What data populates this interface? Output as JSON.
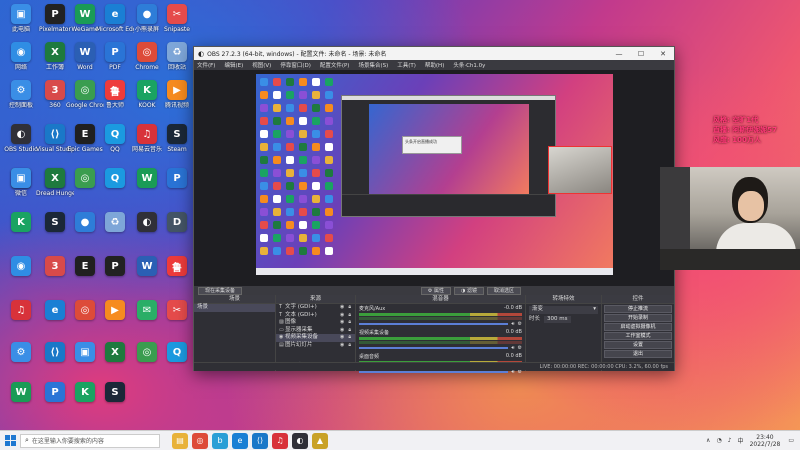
{
  "desktop": {
    "icons": [
      {
        "label": "此电脑",
        "icon": "computer-icon",
        "color": "#3a8ee6",
        "glyph": "▣"
      },
      {
        "label": "Pixelmator",
        "icon": "pixelmator-icon",
        "color": "#222222",
        "glyph": "P"
      },
      {
        "label": "WeGame",
        "icon": "wegame-icon",
        "color": "#1a9b56",
        "glyph": "W"
      },
      {
        "label": "Microsoft Edge",
        "icon": "edge-icon",
        "color": "#1a7fd4",
        "glyph": "e"
      },
      {
        "label": "小熊录屏",
        "icon": "recorder-icon",
        "color": "#2e7dd8",
        "glyph": "●"
      },
      {
        "label": "Snipaste",
        "icon": "snipaste-icon",
        "color": "#e54b4b",
        "glyph": "✂"
      },
      {
        "label": "网络",
        "icon": "network-icon",
        "color": "#2f8de4",
        "glyph": "◉"
      },
      {
        "label": "工作簿",
        "icon": "excel-icon",
        "color": "#1e7a3e",
        "glyph": "X"
      },
      {
        "label": "Word",
        "icon": "word-icon",
        "color": "#2b5fb4",
        "glyph": "W"
      },
      {
        "label": "PDF",
        "icon": "pdf-icon",
        "color": "#2a74d6",
        "glyph": "P"
      },
      {
        "label": "Chrome",
        "icon": "chrome-icon",
        "color": "#dd4b39",
        "glyph": "◎"
      },
      {
        "label": "回收站",
        "icon": "recycle-bin-icon",
        "color": "#7ea6d8",
        "glyph": "♻"
      },
      {
        "label": "控制面板",
        "icon": "control-panel-icon",
        "color": "#3a8ee6",
        "glyph": "⚙"
      },
      {
        "label": "360",
        "icon": "app-icon",
        "color": "#d84a4a",
        "glyph": "3"
      },
      {
        "label": "Google Chrome",
        "icon": "chrome-icon",
        "color": "#3a9d4f",
        "glyph": "◎"
      },
      {
        "label": "鲁大师",
        "icon": "app-icon",
        "color": "#ee3b3b",
        "glyph": "鲁"
      },
      {
        "label": "KOOK",
        "icon": "kook-icon",
        "color": "#1aa362",
        "glyph": "K"
      },
      {
        "label": "腾讯视频",
        "icon": "video-icon",
        "color": "#f68b1f",
        "glyph": "▶"
      },
      {
        "label": "OBS Studio",
        "icon": "obs-icon",
        "color": "#303038",
        "glyph": "◐"
      },
      {
        "label": "Visual Studio Code",
        "icon": "vscode-icon",
        "color": "#1a78c8",
        "glyph": "⟨⟩"
      },
      {
        "label": "Epic Games",
        "icon": "epic-icon",
        "color": "#202020",
        "glyph": "E"
      },
      {
        "label": "QQ",
        "icon": "qq-icon",
        "color": "#1b9ae0",
        "glyph": "Q"
      },
      {
        "label": "网易云音乐",
        "icon": "music-icon",
        "color": "#d8323a",
        "glyph": "♫"
      },
      {
        "label": "Steam",
        "icon": "steam-icon",
        "color": "#1b2838",
        "glyph": "S"
      },
      {
        "label": "微信",
        "icon": "wechat-icon",
        "color": "#2aae67",
        "glyph": "✉"
      },
      {
        "label": "Dread Hunger",
        "icon": "game-icon",
        "color": "#445566",
        "glyph": "D"
      }
    ]
  },
  "obs": {
    "title": "OBS 27.2.3 (64-bit, windows) - 配置文件: 未命名 - 场景: 未命名",
    "menu": [
      "文件(F)",
      "编辑(E)",
      "视图(V)",
      "停靠窗口(D)",
      "配置文件(P)",
      "场景集合(S)",
      "工具(T)",
      "帮助(H)",
      "头条·Ch1.0y"
    ],
    "toolbar": {
      "scene_chip": "现在采集设备",
      "properties": "属性",
      "filters": "滤镜",
      "deinterlace": "取消选区"
    },
    "docks": {
      "scenes": {
        "title": "场景",
        "items": [
          "场景"
        ]
      },
      "sources": {
        "title": "来源",
        "items": [
          "文字 (GDI+)",
          "文本 (GDI+)",
          "图像",
          "显示器采集",
          "视频采集设备",
          "图片幻灯片"
        ]
      },
      "mixer": {
        "title": "混音器",
        "channels": [
          {
            "name": "麦克风/Aux",
            "db": "-0.0 dB"
          },
          {
            "name": "视频采集设备",
            "db": "0.0 dB"
          },
          {
            "name": "桌面音频",
            "db": "0.0 dB"
          }
        ]
      },
      "transitions": {
        "title": "转场特效",
        "mode": "渐变",
        "duration_label": "时长",
        "duration": "300 ms"
      },
      "controls": {
        "title": "控件",
        "buttons": [
          "停止推流",
          "开始录制",
          "启动虚拟摄像机",
          "工作室模式",
          "设置",
          "退出"
        ]
      }
    },
    "status": "LIVE: 00:00:00   REC: 00:00:00   CPU: 3.2%, 60.00 fps",
    "canvas_toast": "头条开启直播成功"
  },
  "overlay": {
    "lines": [
      "风格: 空旷1代",
      "直播: 阿斯伊妮妮57",
      "风度: 100万人"
    ]
  },
  "taskbar": {
    "search_placeholder": "在这里输入你要搜索的内容",
    "apps": [
      {
        "icon": "folder-icon",
        "color": "#e8b23a",
        "glyph": "▤"
      },
      {
        "icon": "chrome-icon",
        "color": "#dd4b39",
        "glyph": "◎"
      },
      {
        "icon": "bilibili-icon",
        "color": "#2a9fd6",
        "glyph": "b"
      },
      {
        "icon": "edge-icon",
        "color": "#1a7fd4",
        "glyph": "e"
      },
      {
        "icon": "vscode-icon",
        "color": "#1a78c8",
        "glyph": "⟨⟩"
      },
      {
        "icon": "netease-music-icon",
        "color": "#d8323a",
        "glyph": "♫"
      },
      {
        "icon": "obs-icon",
        "color": "#303038",
        "glyph": "◐"
      },
      {
        "icon": "game-icon",
        "color": "#c9a227",
        "glyph": "▲"
      }
    ],
    "time": "23:40",
    "date": "2022/7/28"
  }
}
